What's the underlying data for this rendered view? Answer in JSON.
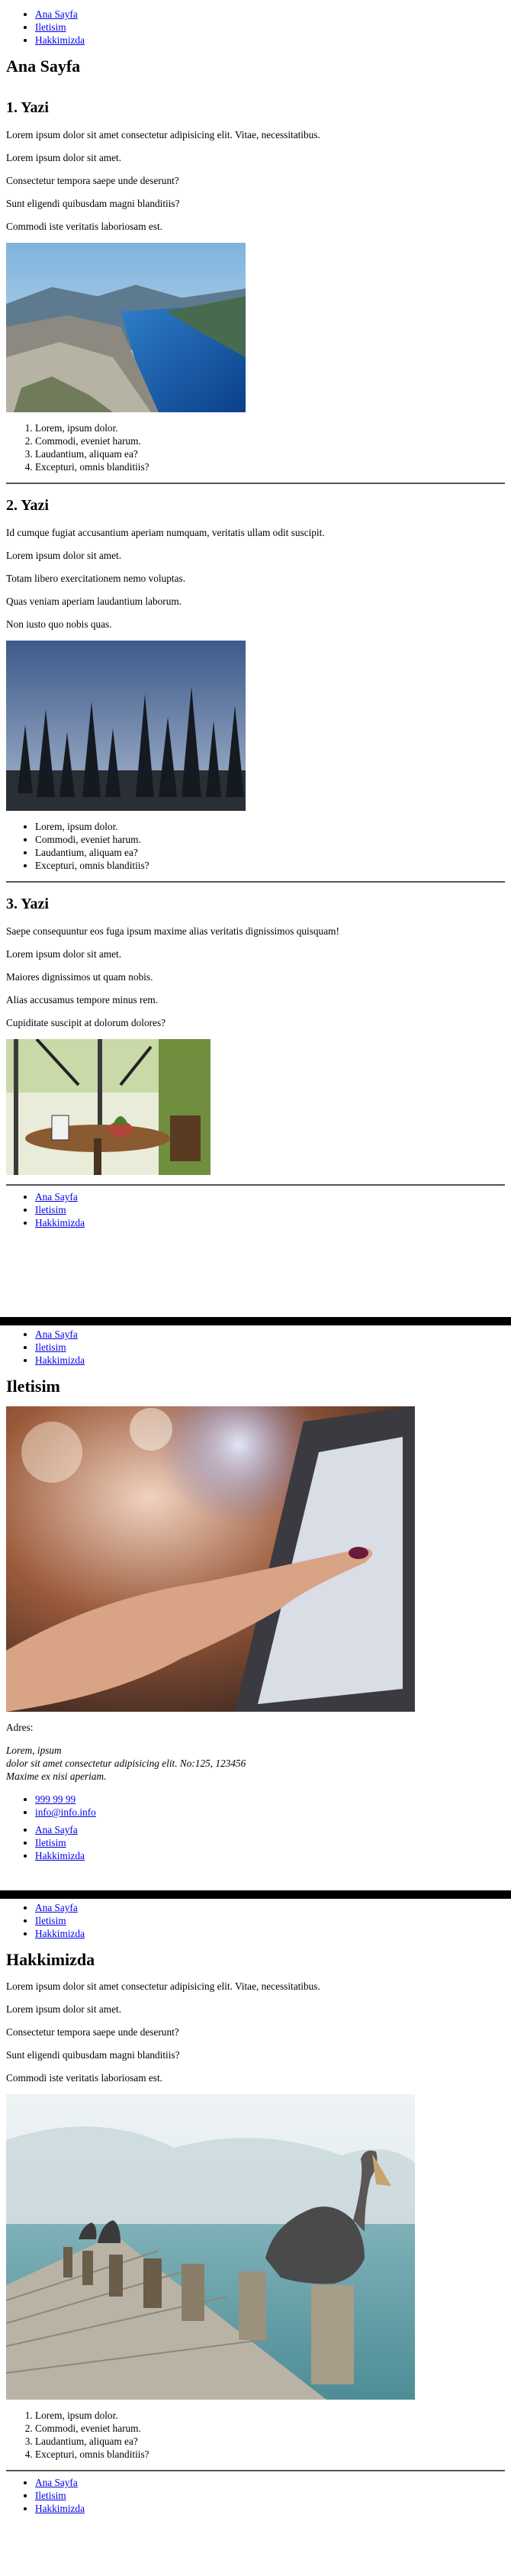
{
  "nav": [
    "Ana Sayfa",
    "Iletisim",
    "Hakkimizda"
  ],
  "home": {
    "title": "Ana Sayfa",
    "posts": [
      {
        "heading": "1. Yazi",
        "paragraphs": [
          "Lorem ipsum dolor sit amet consectetur adipisicing elit. Vitae, necessitatibus.",
          "Lorem ipsum dolor sit amet.",
          "Consectetur tempora saepe unde deserunt?",
          "Sunt eligendi quibusdam magni blanditiis?",
          "Commodi iste veritatis laboriosam est."
        ],
        "list": [
          "Lorem, ipsum dolor.",
          "Commodi, eveniet harum.",
          "Laudantium, aliquam ea?",
          "Excepturi, omnis blanditiis?"
        ]
      },
      {
        "heading": "2. Yazi",
        "paragraphs": [
          "Id cumque fugiat accusantium aperiam numquam, veritatis ullam odit suscipit.",
          "Lorem ipsum dolor sit amet.",
          "Totam libero exercitationem nemo voluptas.",
          "Quas veniam aperiam laudantium laborum.",
          "Non iusto quo nobis quas."
        ],
        "list": [
          "Lorem, ipsum dolor.",
          "Commodi, eveniet harum.",
          "Laudantium, aliquam ea?",
          "Excepturi, omnis blanditiis?"
        ]
      },
      {
        "heading": "3. Yazi",
        "paragraphs": [
          "Saepe consequuntur eos fuga ipsum maxime alias veritatis dignissimos quisquam!",
          "Lorem ipsum dolor sit amet.",
          "Maiores dignissimos ut quam nobis.",
          "Alias accusamus tempore minus rem.",
          "Cupiditate suscipit at dolorum dolores?"
        ]
      }
    ]
  },
  "contact": {
    "title": "Iletisim",
    "address_label": "Adres:",
    "address_lines": [
      "Lorem, ipsum",
      "dolor sit amet consectetur adipisicing elit. No:125, 123456",
      "Maxime ex nisi aperiam."
    ],
    "phone": "999 99 99",
    "email": "info@info.info"
  },
  "about": {
    "title": "Hakkimizda",
    "paragraphs": [
      "Lorem ipsum dolor sit amet consectetur adipisicing elit. Vitae, necessitatibus.",
      "Lorem ipsum dolor sit amet.",
      "Consectetur tempora saepe unde deserunt?",
      "Sunt eligendi quibusdam magni blanditiis?",
      "Commodi iste veritatis laboriosam est."
    ],
    "list": [
      "Lorem, ipsum dolor.",
      "Commodi, eveniet harum.",
      "Laudantium, aliquam ea?",
      "Excepturi, omnis blanditiis?"
    ]
  }
}
